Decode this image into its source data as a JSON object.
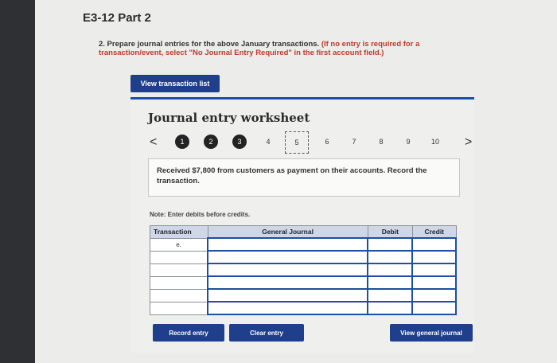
{
  "page": {
    "title": "E3-12 Part 2",
    "instructions_main": "2. Prepare journal entries for the above January transactions.",
    "instructions_red": "(If no entry is required for a transaction/event, select \"No Journal Entry Required\" in the first account field.)"
  },
  "buttons": {
    "view_transaction_list": "View transaction list",
    "record_entry": "Record entry",
    "clear_entry": "Clear entry",
    "view_general_journal": "View general journal"
  },
  "worksheet": {
    "title": "Journal entry worksheet",
    "prev_arrow": "<",
    "next_arrow": ">",
    "steps": [
      "1",
      "2",
      "3",
      "4",
      "5",
      "6",
      "7",
      "8",
      "9",
      "10"
    ],
    "current_step": "5",
    "prompt": "Received $7,800 from customers as payment on their accounts. Record the transaction.",
    "note": "Note: Enter debits before credits."
  },
  "table": {
    "headers": {
      "transaction": "Transaction",
      "general_journal": "General Journal",
      "debit": "Debit",
      "credit": "Credit"
    },
    "first_row_label": "e."
  },
  "colors": {
    "accent": "#1f3f8c",
    "worksheet_border": "#1d4fa4",
    "instruction_red": "#c0392b"
  }
}
